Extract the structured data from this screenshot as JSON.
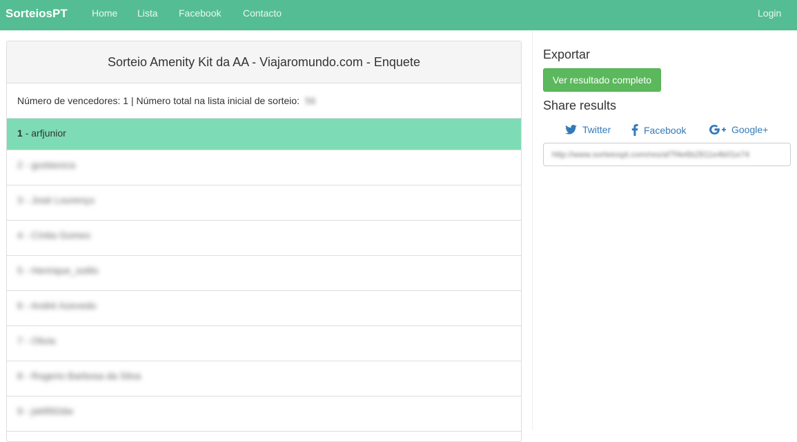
{
  "navbar": {
    "brand": "SorteiosPT",
    "links": [
      "Home",
      "Lista",
      "Facebook",
      "Contacto"
    ],
    "login": "Login",
    "color": "#55bd93"
  },
  "panel": {
    "title": "Sorteio Amenity Kit da AA - Viajaromundo.com - Enquete",
    "info_text": "Número de vencedores: 1 | Número total na lista inicial de sorteio:",
    "info_count_blurred": "56",
    "entries": [
      {
        "num": "1",
        "name": "arfjunior",
        "winner": true
      },
      {
        "num": "2",
        "name": "gustavoca",
        "winner": false
      },
      {
        "num": "3",
        "name": "José Lourenço",
        "winner": false
      },
      {
        "num": "4",
        "name": "Cíntia Gomes",
        "winner": false
      },
      {
        "num": "5",
        "name": "Henrique_sotilo",
        "winner": false
      },
      {
        "num": "6",
        "name": "André Azevedo",
        "winner": false
      },
      {
        "num": "7",
        "name": "Olivia",
        "winner": false
      },
      {
        "num": "8",
        "name": "Rogerio Barbosa da Silva",
        "winner": false
      },
      {
        "num": "9",
        "name": "jskfil92dw",
        "winner": false
      }
    ],
    "winner_color": "#7ddcb5"
  },
  "sidebar": {
    "export_title": "Exportar",
    "result_button": "Ver resultado completo",
    "share_title": "Share results",
    "share": {
      "twitter": "Twitter",
      "facebook": "Facebook",
      "google": "Google+"
    },
    "share_url": "http://www.sorteiospt.com/res/af7f4e6b2811e4b01e74"
  }
}
